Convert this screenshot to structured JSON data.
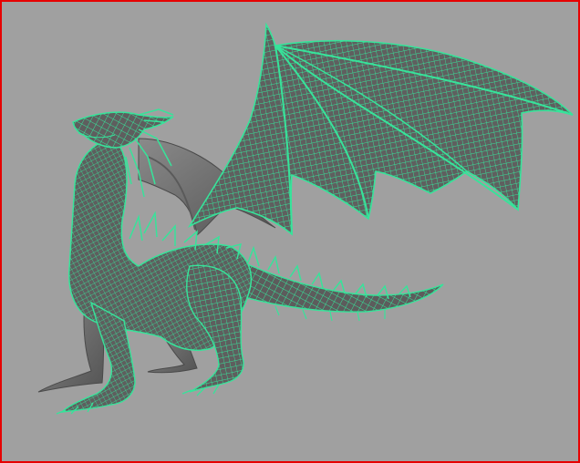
{
  "viewport": {
    "background": "#a0a0a0",
    "active_border_color": "#e60000"
  },
  "model": {
    "subject": "dragon",
    "display_mode": "wireframe-on-shaded",
    "wireframe_color": "#37e39a",
    "shaded_color": "#6f6f6f"
  }
}
